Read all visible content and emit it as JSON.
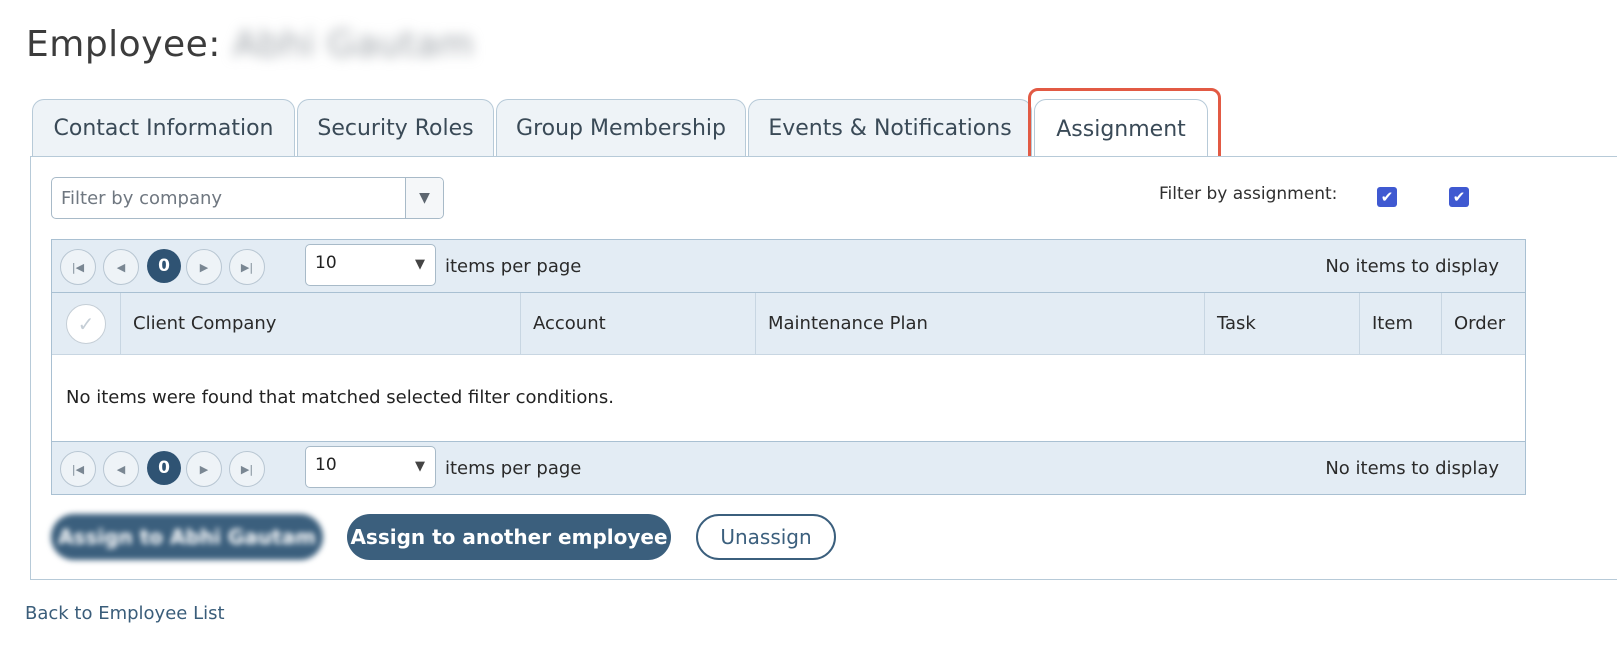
{
  "header": {
    "title_prefix": "Employee:",
    "employee_name": "Abhi Gautam"
  },
  "tabs": [
    {
      "label": "Contact Information"
    },
    {
      "label": "Security Roles"
    },
    {
      "label": "Group Membership"
    },
    {
      "label": "Events & Notifications"
    },
    {
      "label": "Assignment",
      "active": true
    }
  ],
  "filters": {
    "company_placeholder": "Filter by company",
    "assignment_label": "Filter by assignment:",
    "assignment_checkbox_1": true,
    "assignment_checkbox_2": true
  },
  "pager": {
    "current_page": "0",
    "page_size": "10",
    "page_size_label": "items per page",
    "status": "No items to display"
  },
  "grid": {
    "columns": [
      "Client Company",
      "Account",
      "Maintenance Plan",
      "Task",
      "Item",
      "Order"
    ],
    "empty_message": "No items were found that matched selected filter conditions."
  },
  "actions": {
    "assign_self": "Assign to Abhi Gautam",
    "assign_other": "Assign to another employee",
    "unassign": "Unassign"
  },
  "footer": {
    "back_link": "Back to Employee List"
  },
  "colors": {
    "primary": "#3b5f7d",
    "highlight": "#e25a44",
    "header_bg": "#e3ecf4",
    "checkbox": "#3f59d1"
  }
}
